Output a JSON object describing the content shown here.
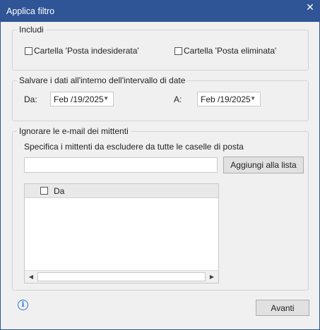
{
  "window": {
    "title": "Applica filtro",
    "close_glyph": "✕"
  },
  "includi": {
    "legend": "Includi",
    "junk_label": "Cartella 'Posta indesiderata'",
    "deleted_label": "Cartella 'Posta eliminata'"
  },
  "date_range": {
    "legend": "Salvare i dati all'interno dell'intervallo di date",
    "from_label": "Da:",
    "from_value": "Feb /19/2025",
    "to_label": "A:",
    "to_value": "Feb /19/2025"
  },
  "senders": {
    "legend": "Ignorare le e-mail dei mittenti",
    "instruction": "Specifica i mittenti da escludere da tutte le caselle di posta",
    "input_value": "",
    "add_button": "Aggiungi alla lista",
    "list_header": "Da"
  },
  "footer": {
    "next_button": "Avanti",
    "info_icon": "i"
  },
  "icons": {
    "dropdown": "▼",
    "scroll_left": "◀",
    "scroll_right": "▶"
  },
  "colors": {
    "titlebar": "#2f5597",
    "info": "#2a73d9"
  }
}
